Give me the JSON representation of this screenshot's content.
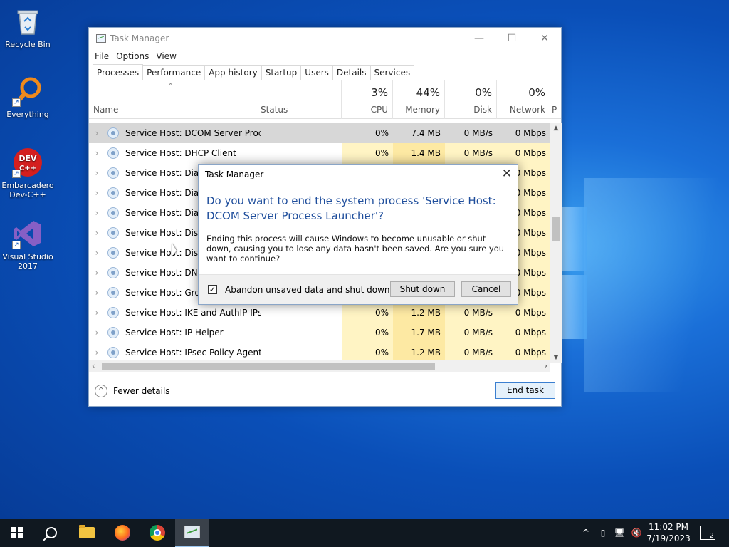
{
  "desktop": {
    "icons": [
      {
        "label": "Recycle Bin",
        "icon": "recycle-bin-icon"
      },
      {
        "label": "Everything",
        "icon": "everything-search-icon"
      },
      {
        "label": "Embarcadero Dev-C++",
        "icon": "devcpp-icon",
        "badge": "DEV C++"
      },
      {
        "label": "Visual Studio 2017",
        "icon": "visual-studio-icon"
      }
    ]
  },
  "task_manager": {
    "title": "Task Manager",
    "menu": [
      "File",
      "Options",
      "View"
    ],
    "tabs": [
      "Processes",
      "Performance",
      "App history",
      "Startup",
      "Users",
      "Details",
      "Services"
    ],
    "active_tab": "Processes",
    "columns": {
      "name": "Name",
      "status": "Status",
      "cpu": {
        "pct": "3%",
        "label": "CPU"
      },
      "memory": {
        "pct": "44%",
        "label": "Memory"
      },
      "disk": {
        "pct": "0%",
        "label": "Disk"
      },
      "network": {
        "pct": "0%",
        "label": "Network"
      },
      "power": "P"
    },
    "rows": [
      {
        "name": "Service Host: DCOM Server Proc...",
        "cpu": "0%",
        "memory": "7.4 MB",
        "disk": "0 MB/s",
        "network": "0 Mbps"
      },
      {
        "name": "Service Host: DHCP Client",
        "cpu": "0%",
        "memory": "1.4 MB",
        "disk": "0 MB/s",
        "network": "0 Mbps"
      },
      {
        "name": "Service Host: Diagn",
        "cpu": "",
        "memory": "",
        "disk": "",
        "network": "0 Mbps"
      },
      {
        "name": "Service Host: Diagn",
        "cpu": "",
        "memory": "",
        "disk": "",
        "network": "0 Mbps"
      },
      {
        "name": "Service Host: Diagn",
        "cpu": "",
        "memory": "",
        "disk": "",
        "network": "0 Mbps"
      },
      {
        "name": "Service Host: Displa",
        "cpu": "",
        "memory": "",
        "disk": "",
        "network": "0 Mbps"
      },
      {
        "name": "Service Host: Distrib",
        "cpu": "",
        "memory": "",
        "disk": "",
        "network": "0 Mbps"
      },
      {
        "name": "Service Host: DNS C",
        "cpu": "",
        "memory": "",
        "disk": "",
        "network": "0 Mbps"
      },
      {
        "name": "Service Host: Group",
        "cpu": "",
        "memory": "",
        "disk": "",
        "network": "0 Mbps"
      },
      {
        "name": "Service Host: IKE and AuthIP IPs...",
        "cpu": "0%",
        "memory": "1.2 MB",
        "disk": "0 MB/s",
        "network": "0 Mbps"
      },
      {
        "name": "Service Host: IP Helper",
        "cpu": "0%",
        "memory": "1.7 MB",
        "disk": "0 MB/s",
        "network": "0 Mbps"
      },
      {
        "name": "Service Host: IPsec Policy Agent",
        "cpu": "0%",
        "memory": "1.2 MB",
        "disk": "0 MB/s",
        "network": "0 Mbps"
      }
    ],
    "footer": {
      "fewer_details": "Fewer details",
      "end_task": "End task"
    }
  },
  "dialog": {
    "title": "Task Manager",
    "heading": "Do you want to end the system process 'Service Host: DCOM Server Process Launcher'?",
    "body": "Ending this process will cause Windows to become unusable or shut down, causing you to lose any data hasn't been saved. Are you sure you want to continue?",
    "checkbox_label": "Abandon unsaved data and shut down.",
    "checkbox_checked": true,
    "checkbox_mark": "✓",
    "shutdown_label": "Shut down",
    "cancel_label": "Cancel"
  },
  "taskbar": {
    "time": "11:02 PM",
    "date": "7/19/2023",
    "notification_count": "2"
  }
}
